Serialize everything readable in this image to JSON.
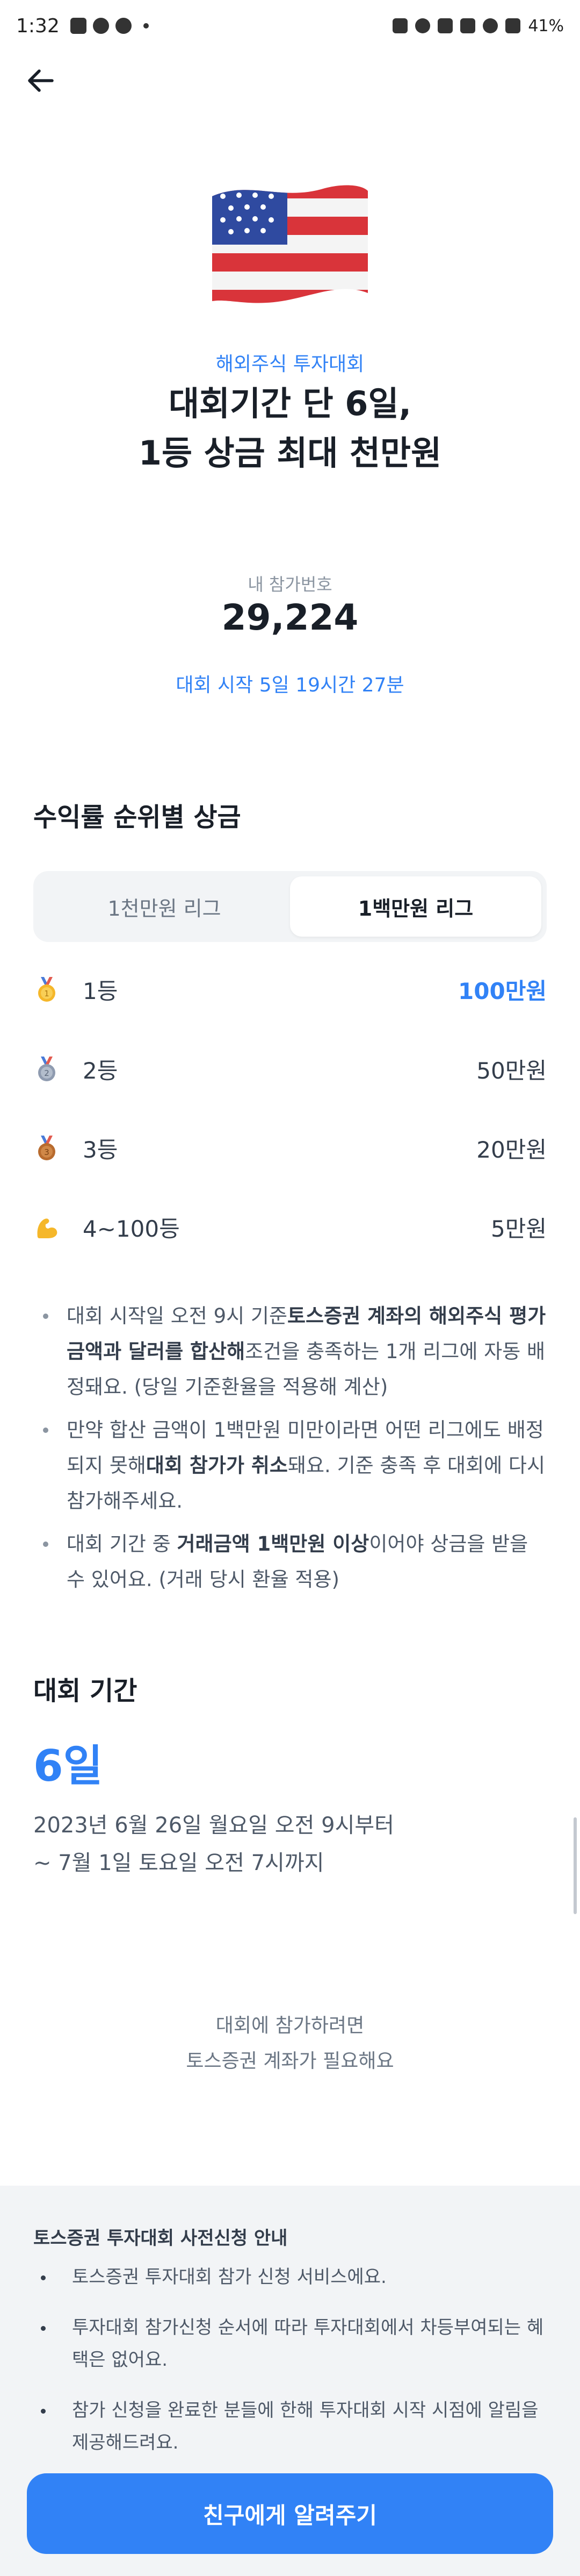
{
  "status_bar": {
    "time": "1:32",
    "battery": "41%"
  },
  "hero": {
    "eyebrow": "해외주식 투자대회",
    "headline_line1": "대회기간 단 6일,",
    "headline_line2": "1등 상금 최대 천만원"
  },
  "entry": {
    "label": "내 참가번호",
    "number": "29,224",
    "countdown": "대회 시작 5일 19시간 27분"
  },
  "prizes": {
    "title": "수익률 순위별 상금",
    "tabs": [
      "1천만원 리그",
      "1백만원 리그"
    ],
    "rows": [
      {
        "rank": "1등",
        "amount": "100만원"
      },
      {
        "rank": "2등",
        "amount": "50만원"
      },
      {
        "rank": "3등",
        "amount": "20만원"
      },
      {
        "rank": "4~100등",
        "amount": "5만원"
      }
    ],
    "notes": [
      {
        "parts": [
          "대회 시작일 오전 9시 기준",
          "토스증권 계좌의 해외주식 평가금액과 달러를 합산해",
          "조건을 충족하는 1개 리그에 자동 배정돼요. (당일 기준환율을 적용해 계산)"
        ]
      },
      {
        "parts": [
          "만약 합산 금액이 1백만원 미만이라면 어떤 리그에도 배정되지 못해",
          "대회 참가가 취소",
          "돼요. 기준 충족 후 대회에 다시 참가해주세요."
        ]
      },
      {
        "parts": [
          "대회 기간 중 ",
          "거래금액 1백만원 이상",
          "이어야 상금을 받을 수 있어요. (거래 당시 환율 적용)"
        ]
      }
    ]
  },
  "period": {
    "title": "대회 기간",
    "days": "6일",
    "line1": "2023년 6월 26일 월요일 오전 9시부터",
    "line2": "~ 7월 1일 토요일 오전 7시까지"
  },
  "join_hint": {
    "line1": "대회에 참가하려면",
    "line2": "토스증권 계좌가 필요해요"
  },
  "guide": {
    "title": "토스증권 투자대회 사전신청 안내",
    "items": [
      "토스증권 투자대회 참가 신청 서비스에요.",
      "투자대회 참가신청 순서에 따라 투자대회에서 차등부여되는 혜택은 없어요.",
      "참가 신청을 완료한 분들에 한해 투자대회 시작 시점에 알림을 제공해드려요."
    ]
  },
  "cta": {
    "label": "친구에게 알려주기"
  },
  "colors": {
    "accent": "#3182f6",
    "panel": "#f2f4f6",
    "text": "#191f28"
  }
}
